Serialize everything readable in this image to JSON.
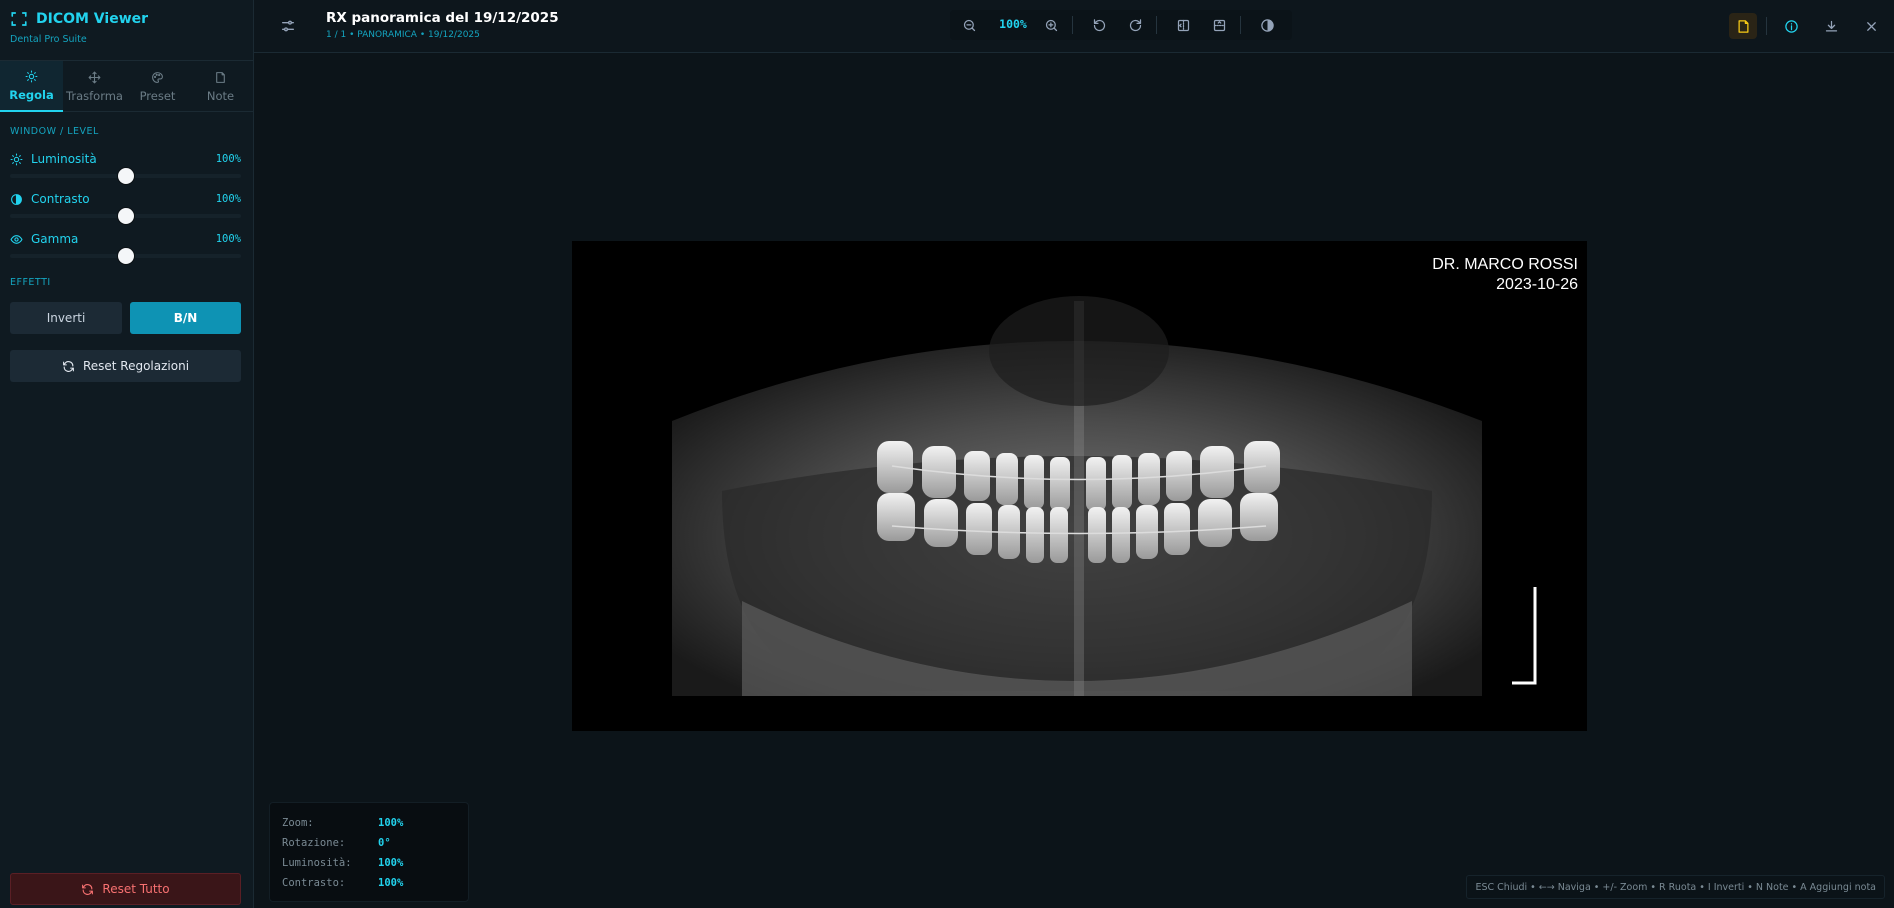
{
  "brand": {
    "title": "DICOM Viewer",
    "subtitle": "Dental Pro Suite"
  },
  "tabs": [
    {
      "label": "Regola",
      "icon": "sun-icon",
      "active": true
    },
    {
      "label": "Trasforma",
      "icon": "move-icon",
      "active": false
    },
    {
      "label": "Preset",
      "icon": "palette-icon",
      "active": false
    },
    {
      "label": "Note",
      "icon": "note-icon",
      "active": false
    }
  ],
  "window_level": {
    "section_label": "WINDOW / LEVEL",
    "sliders": [
      {
        "label": "Luminosità",
        "value_text": "100%",
        "level": 0.5,
        "icon": "sun-icon"
      },
      {
        "label": "Contrasto",
        "value_text": "100%",
        "level": 0.5,
        "icon": "contrast-icon"
      },
      {
        "label": "Gamma",
        "value_text": "100%",
        "level": 0.5,
        "icon": "eye-icon"
      }
    ]
  },
  "effects": {
    "section_label": "EFFETTI",
    "invert_label": "Inverti",
    "bw_label": "B/N",
    "bw_active": true,
    "reset_label": "Reset Regolazioni"
  },
  "reset_all_label": "Reset Tutto",
  "header": {
    "title": "RX panoramica del 19/12/2025",
    "subtitle": "1 / 1 • PANORAMICA • 19/12/2025"
  },
  "toolbar": {
    "zoom": "100%"
  },
  "image": {
    "doctor": "DR. MARCO ROSSI",
    "date": "2023-10-26"
  },
  "info": [
    {
      "label": "Zoom:",
      "value": "100%"
    },
    {
      "label": "Rotazione:",
      "value": "0°"
    },
    {
      "label": "Luminosità:",
      "value": "100%"
    },
    {
      "label": "Contrasto:",
      "value": "100%"
    }
  ],
  "shortcuts": "ESC Chiudi • ←→ Naviga • +/- Zoom • R Ruota • I Inverti • N Note • A Aggiungi nota",
  "colors": {
    "accent": "#22d3ee",
    "active_button": "#0e93b4",
    "danger": "#f87171",
    "note_active": "#facc15"
  }
}
